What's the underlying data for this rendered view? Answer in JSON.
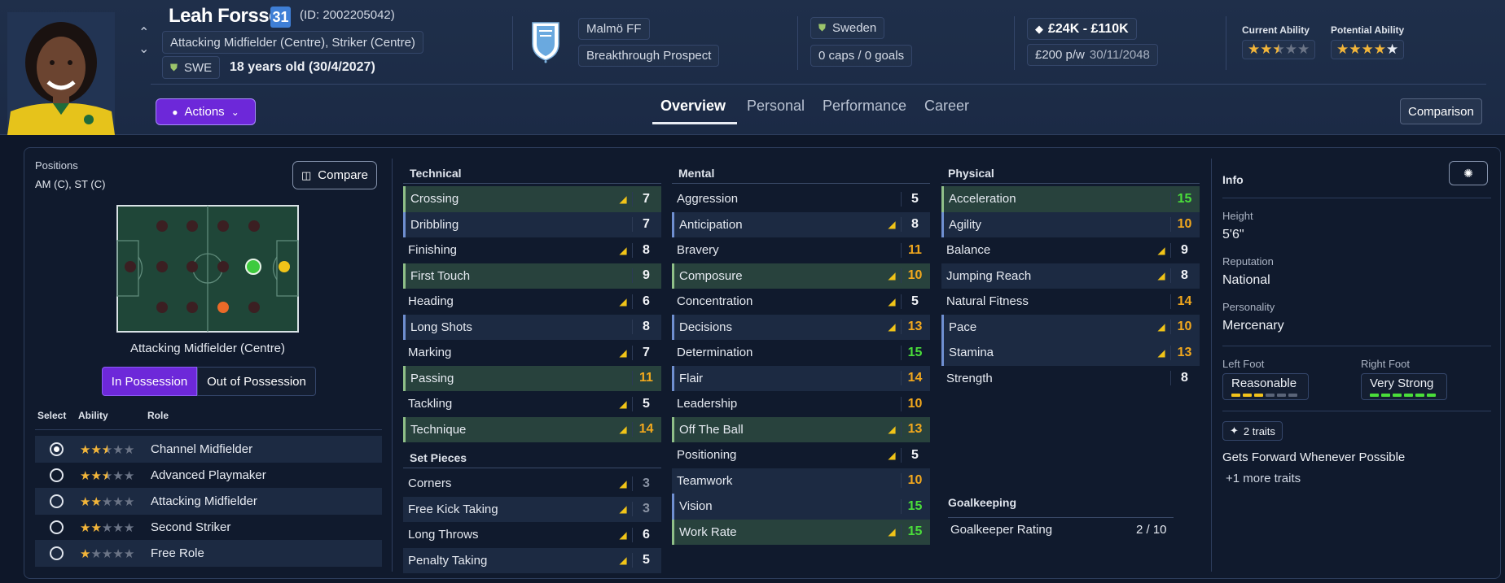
{
  "player": {
    "name": "Leah Forssell",
    "age": "31",
    "id_text": "(ID: 2002205042)",
    "positions_text": "Attacking Midfielder (Centre), Striker (Centre)",
    "nation_code": "SWE",
    "age_text": "18 years old (30/4/2027)",
    "photo_icon": "player-portrait"
  },
  "club": {
    "name": "Malmö FF",
    "status": "Breakthrough Prospect"
  },
  "nation": {
    "name": "Sweden",
    "caps": "0 caps / 0 goals"
  },
  "value": {
    "range": "£24K - £110K",
    "wage": "£200 p/w",
    "contract": "30/11/2048"
  },
  "ability": {
    "current_label": "Current Ability",
    "potential_label": "Potential Ability",
    "current_stars": 2.5,
    "potential_stars": 4.5
  },
  "actions_label": "Actions",
  "tabs": [
    "Overview",
    "Personal",
    "Performance",
    "Career"
  ],
  "active_tab": "Overview",
  "comparison_label": "Comparison",
  "positions": {
    "title": "Positions",
    "short": "AM (C), ST (C)",
    "compare_label": "Compare",
    "selected_name": "Attacking Midfielder (Centre)"
  },
  "possession": {
    "in": "In Possession",
    "out": "Out of Possession"
  },
  "roles_header": {
    "select": "Select",
    "ability": "Ability",
    "role": "Role"
  },
  "roles": [
    {
      "name": "Channel Midfielder",
      "stars": 2.5,
      "selected": true
    },
    {
      "name": "Advanced Playmaker",
      "stars": 2.5,
      "selected": false
    },
    {
      "name": "Attacking Midfielder",
      "stars": 2,
      "selected": false
    },
    {
      "name": "Second Striker",
      "stars": 2,
      "selected": false
    },
    {
      "name": "Free Role",
      "stars": 1,
      "selected": false
    }
  ],
  "technical": {
    "title": "Technical",
    "rows": [
      {
        "name": "Crossing",
        "value": "7",
        "trend": true,
        "color": "w",
        "style": "green gl"
      },
      {
        "name": "Dribbling",
        "value": "7",
        "trend": false,
        "color": "w",
        "style": "shade blue"
      },
      {
        "name": "Finishing",
        "value": "8",
        "trend": true,
        "color": "w",
        "style": ""
      },
      {
        "name": "First Touch",
        "value": "9",
        "trend": false,
        "color": "w",
        "style": "green gl"
      },
      {
        "name": "Heading",
        "value": "6",
        "trend": true,
        "color": "w",
        "style": ""
      },
      {
        "name": "Long Shots",
        "value": "8",
        "trend": false,
        "color": "w",
        "style": "shade blue"
      },
      {
        "name": "Marking",
        "value": "7",
        "trend": true,
        "color": "w",
        "style": ""
      },
      {
        "name": "Passing",
        "value": "11",
        "trend": false,
        "color": "y",
        "style": "green gl"
      },
      {
        "name": "Tackling",
        "value": "5",
        "trend": true,
        "color": "w",
        "style": ""
      },
      {
        "name": "Technique",
        "value": "14",
        "trend": true,
        "color": "y",
        "style": "green gl"
      }
    ]
  },
  "set_pieces": {
    "title": "Set Pieces",
    "rows": [
      {
        "name": "Corners",
        "value": "3",
        "trend": true,
        "color": "d",
        "style": ""
      },
      {
        "name": "Free Kick Taking",
        "value": "3",
        "trend": true,
        "color": "d",
        "style": "shade"
      },
      {
        "name": "Long Throws",
        "value": "6",
        "trend": true,
        "color": "w",
        "style": ""
      },
      {
        "name": "Penalty Taking",
        "value": "5",
        "trend": true,
        "color": "w",
        "style": "shade"
      }
    ]
  },
  "mental": {
    "title": "Mental",
    "rows": [
      {
        "name": "Aggression",
        "value": "5",
        "trend": false,
        "color": "w",
        "style": ""
      },
      {
        "name": "Anticipation",
        "value": "8",
        "trend": true,
        "color": "w",
        "style": "shade blue"
      },
      {
        "name": "Bravery",
        "value": "11",
        "trend": false,
        "color": "y",
        "style": ""
      },
      {
        "name": "Composure",
        "value": "10",
        "trend": true,
        "color": "y",
        "style": "green gl"
      },
      {
        "name": "Concentration",
        "value": "5",
        "trend": true,
        "color": "w",
        "style": ""
      },
      {
        "name": "Decisions",
        "value": "13",
        "trend": true,
        "color": "y",
        "style": "shade blue"
      },
      {
        "name": "Determination",
        "value": "15",
        "trend": false,
        "color": "g",
        "style": ""
      },
      {
        "name": "Flair",
        "value": "14",
        "trend": false,
        "color": "y",
        "style": "shade blue"
      },
      {
        "name": "Leadership",
        "value": "10",
        "trend": false,
        "color": "y",
        "style": ""
      },
      {
        "name": "Off The Ball",
        "value": "13",
        "trend": true,
        "color": "y",
        "style": "green gl"
      },
      {
        "name": "Positioning",
        "value": "5",
        "trend": true,
        "color": "w",
        "style": ""
      },
      {
        "name": "Teamwork",
        "value": "10",
        "trend": false,
        "color": "y",
        "style": "shade"
      },
      {
        "name": "Vision",
        "value": "15",
        "trend": false,
        "color": "g",
        "style": "shade blue"
      },
      {
        "name": "Work Rate",
        "value": "15",
        "trend": true,
        "color": "g",
        "style": "green gl"
      }
    ]
  },
  "physical": {
    "title": "Physical",
    "rows": [
      {
        "name": "Acceleration",
        "value": "15",
        "trend": false,
        "color": "g",
        "style": "green gl"
      },
      {
        "name": "Agility",
        "value": "10",
        "trend": false,
        "color": "y",
        "style": "shade blue"
      },
      {
        "name": "Balance",
        "value": "9",
        "trend": true,
        "color": "w",
        "style": ""
      },
      {
        "name": "Jumping Reach",
        "value": "8",
        "trend": true,
        "color": "w",
        "style": "shade"
      },
      {
        "name": "Natural Fitness",
        "value": "14",
        "trend": false,
        "color": "y",
        "style": ""
      },
      {
        "name": "Pace",
        "value": "10",
        "trend": true,
        "color": "y",
        "style": "shade blue"
      },
      {
        "name": "Stamina",
        "value": "13",
        "trend": true,
        "color": "y",
        "style": "shade blue"
      },
      {
        "name": "Strength",
        "value": "8",
        "trend": false,
        "color": "w",
        "style": ""
      }
    ]
  },
  "goalkeeping": {
    "title": "Goalkeeping",
    "label": "Goalkeeper Rating",
    "value": "2 / 10"
  },
  "info": {
    "title": "Info",
    "height_label": "Height",
    "height": "5'6\"",
    "reputation_label": "Reputation",
    "reputation": "National",
    "personality_label": "Personality",
    "personality": "Mercenary",
    "left_foot_label": "Left Foot",
    "left_foot": "Reasonable",
    "left_level": 3,
    "right_foot_label": "Right Foot",
    "right_foot": "Very Strong",
    "right_level": 6,
    "traits_badge": "2 traits",
    "trait": "Gets Forward Whenever Possible",
    "more_traits": "+1 more traits"
  },
  "colors": {
    "accent": "#6d28d9",
    "yellow": "#f2a81d",
    "green": "#4ade3a",
    "pitch": "#1f4638"
  }
}
